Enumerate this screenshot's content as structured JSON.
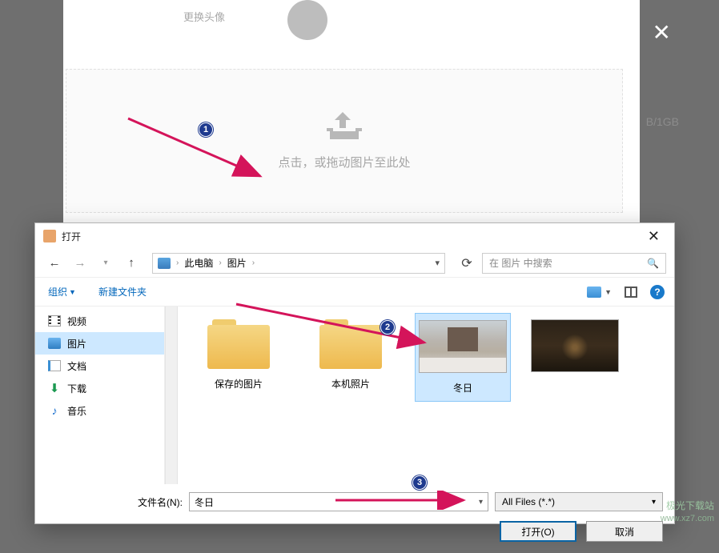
{
  "bg": {
    "header_label": "更换头像",
    "storage_label": "B/1GB",
    "upload_text": "点击，或拖动图片至此处"
  },
  "dialog": {
    "title": "打开",
    "breadcrumb": {
      "root": "此电脑",
      "folder": "图片"
    },
    "search_placeholder": "在 图片 中搜索",
    "toolbar": {
      "organize": "组织",
      "newfolder": "新建文件夹"
    },
    "sidebar": {
      "video": "视频",
      "pictures": "图片",
      "documents": "文档",
      "downloads": "下载",
      "music": "音乐"
    },
    "items": {
      "saved": "保存的图片",
      "camera": "本机照片",
      "winter": "冬日"
    },
    "filename_label": "文件名(N):",
    "filename_value": "冬日",
    "filetype": "All Files (*.*)",
    "open_btn": "打开(O)",
    "cancel_btn": "取消"
  },
  "annotations": {
    "b1": "1",
    "b2": "2",
    "b3": "3"
  },
  "watermark": {
    "line1": "极光下载站",
    "line2": "www.xz7.com"
  }
}
